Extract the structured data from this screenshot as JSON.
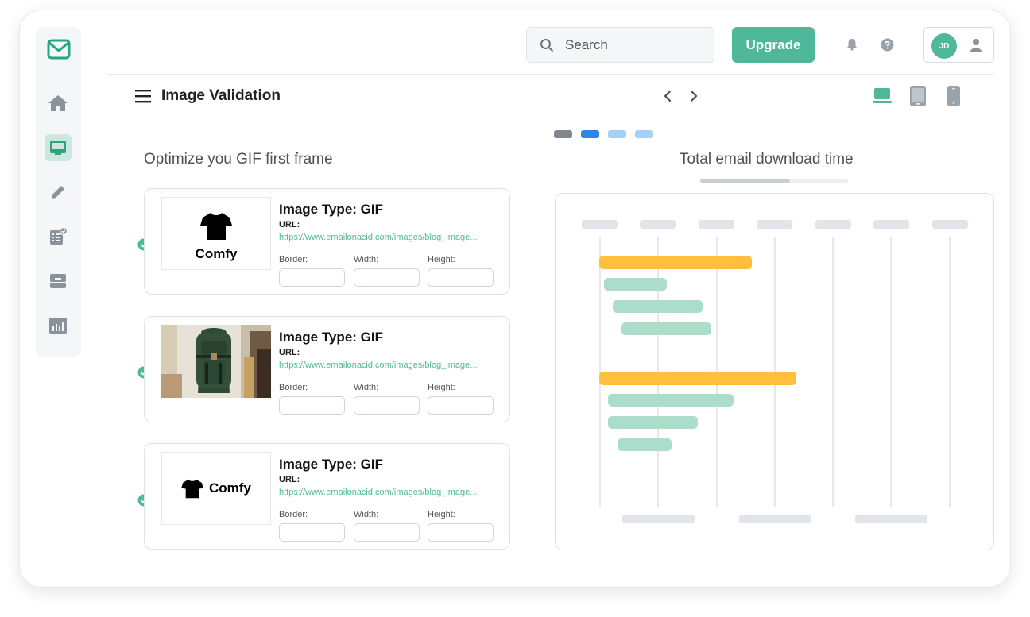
{
  "header": {
    "search": {
      "placeholder": "Search"
    },
    "upgrade_label": "Upgrade",
    "avatar_initials": "JD"
  },
  "sidebar": {
    "items": [
      {
        "icon": "home-icon"
      },
      {
        "icon": "inbox-icon",
        "active": true
      },
      {
        "icon": "pencil-icon"
      },
      {
        "icon": "checklist-icon"
      },
      {
        "icon": "layers-icon"
      },
      {
        "icon": "analytics-icon"
      }
    ]
  },
  "toolbar": {
    "title": "Image Validation"
  },
  "left_panel": {
    "title": "Optimize you GIF first frame",
    "cards": [
      {
        "thumb": "comfy-logo-stacked",
        "thumb_text": "Comfy",
        "type_label": "Image Type: GIF",
        "url_label": "URL:",
        "url": "https://www.emailonacid.com/images/blog_image...",
        "fields": [
          "Border:",
          "Width:",
          "Height:"
        ]
      },
      {
        "thumb": "backpack-photo",
        "type_label": "Image Type: GIF",
        "url_label": "URL:",
        "url": "https://www.emailonacid.com/images/blog_image...",
        "fields": [
          "Border:",
          "Width:",
          "Height:"
        ]
      },
      {
        "thumb": "comfy-logo-inline",
        "thumb_text": "Comfy",
        "type_label": "Image Type: GIF",
        "url_label": "URL:",
        "url": "https://www.emailonacid.com/images/blog_image...",
        "fields": [
          "Border:",
          "Width:",
          "Height:"
        ]
      }
    ]
  },
  "right_panel": {
    "title": "Total email download time",
    "progress": 0.61
  },
  "colors": {
    "accent": "#4fb89a",
    "bar_orange": "#ffbe3b",
    "bar_green": "#acdcca",
    "placeholder": "#e1e5e9"
  }
}
